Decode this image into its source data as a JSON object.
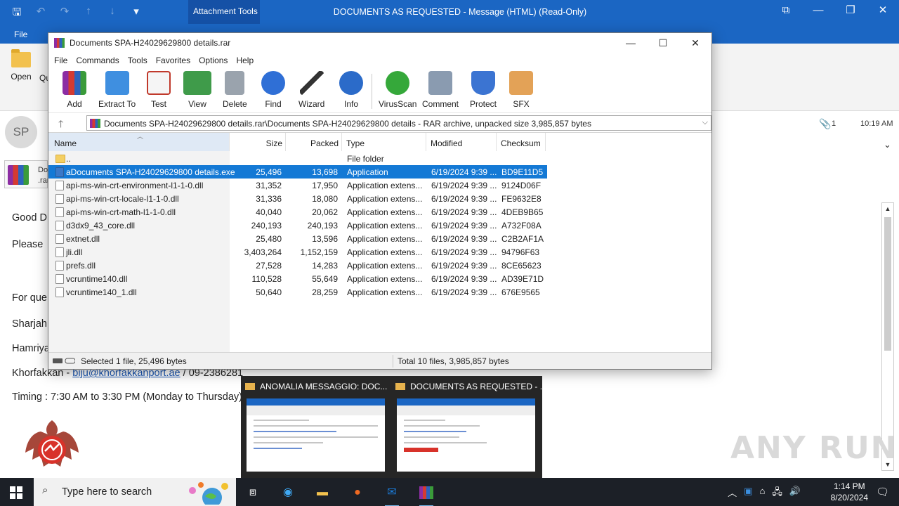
{
  "outlook": {
    "title": "DOCUMENTS AS REQUESTED  -  Message (HTML) (Read-Only)",
    "contextual_tab": "Attachment Tools",
    "file_tab": "File",
    "ribbon_open": "Open",
    "ribbon_qu": "Qu",
    "avatar_initials": "SP",
    "attachment_count": "1",
    "time": "10:19 AM",
    "attachment_name_line1": "Do",
    "attachment_name_line2": ".rar",
    "body": {
      "l1": "Good D",
      "l2": "Please",
      "l3": "For quer",
      "l4": "Sharjah",
      "l5": "Hamriya",
      "l6_prefix": "Khorfakkan - ",
      "l6_email": "biju@khorfakkanport.ae",
      "l6_suffix": " / 09-2386281",
      "l7": "Timing : 7:30 AM to 3:30 PM (Monday to Thursday)"
    }
  },
  "winrar": {
    "title": "Documents SPA-H24029629800 details.rar",
    "menu": [
      "File",
      "Commands",
      "Tools",
      "Favorites",
      "Options",
      "Help"
    ],
    "toolbar": [
      "Add",
      "Extract To",
      "Test",
      "View",
      "Delete",
      "Find",
      "Wizard",
      "Info",
      "VirusScan",
      "Comment",
      "Protect",
      "SFX"
    ],
    "path": "Documents SPA-H24029629800 details.rar\\Documents SPA-H24029629800 details - RAR archive, unpacked size 3,985,857 bytes",
    "columns": {
      "name": "Name",
      "size": "Size",
      "packed": "Packed",
      "type": "Type",
      "modified": "Modified",
      "checksum": "Checksum"
    },
    "files": [
      {
        "name": "..",
        "size": "",
        "packed": "",
        "type": "File folder",
        "modified": "",
        "checksum": "",
        "icon": "folder-icon"
      },
      {
        "name": "aDocuments SPA-H24029629800 details.exe",
        "size": "25,496",
        "packed": "13,698",
        "type": "Application",
        "modified": "6/19/2024 9:39 ...",
        "checksum": "BD9E11D5",
        "icon": "exe-file-icon"
      },
      {
        "name": "api-ms-win-crt-environment-l1-1-0.dll",
        "size": "31,352",
        "packed": "17,950",
        "type": "Application extens...",
        "modified": "6/19/2024 9:39 ...",
        "checksum": "9124D06F",
        "icon": "dll-file-icon"
      },
      {
        "name": "api-ms-win-crt-locale-l1-1-0.dll",
        "size": "31,336",
        "packed": "18,080",
        "type": "Application extens...",
        "modified": "6/19/2024 9:39 ...",
        "checksum": "FE9632E8",
        "icon": "dll-file-icon"
      },
      {
        "name": "api-ms-win-crt-math-l1-1-0.dll",
        "size": "40,040",
        "packed": "20,062",
        "type": "Application extens...",
        "modified": "6/19/2024 9:39 ...",
        "checksum": "4DEB9B65",
        "icon": "dll-file-icon"
      },
      {
        "name": "d3dx9_43_core.dll",
        "size": "240,193",
        "packed": "240,193",
        "type": "Application extens...",
        "modified": "6/19/2024 9:39 ...",
        "checksum": "A732F08A",
        "icon": "dll-file-icon"
      },
      {
        "name": "extnet.dll",
        "size": "25,480",
        "packed": "13,596",
        "type": "Application extens...",
        "modified": "6/19/2024 9:39 ...",
        "checksum": "C2B2AF1A",
        "icon": "dll-file-icon"
      },
      {
        "name": "jli.dll",
        "size": "3,403,264",
        "packed": "1,152,159",
        "type": "Application extens...",
        "modified": "6/19/2024 9:39 ...",
        "checksum": "94796F63",
        "icon": "dll-file-icon"
      },
      {
        "name": "prefs.dll",
        "size": "27,528",
        "packed": "14,283",
        "type": "Application extens...",
        "modified": "6/19/2024 9:39 ...",
        "checksum": "8CE65623",
        "icon": "dll-file-icon"
      },
      {
        "name": "vcruntime140.dll",
        "size": "110,528",
        "packed": "55,649",
        "type": "Application extens...",
        "modified": "6/19/2024 9:39 ...",
        "checksum": "AD39E71D",
        "icon": "dll-file-icon"
      },
      {
        "name": "vcruntime140_1.dll",
        "size": "50,640",
        "packed": "28,259",
        "type": "Application extens...",
        "modified": "6/19/2024 9:39 ...",
        "checksum": "676E9565",
        "icon": "dll-file-icon"
      }
    ],
    "selected_index": 1,
    "status_left": "Selected 1 file, 25,496 bytes",
    "status_right": "Total 10 files, 3,985,857 bytes"
  },
  "thumbnails": [
    {
      "title": "ANOMALIA MESSAGGIO: DOC..."
    },
    {
      "title": "DOCUMENTS AS REQUESTED - ..."
    }
  ],
  "watermark": "ANY RUN",
  "taskbar": {
    "search_placeholder": "Type here to search",
    "time": "1:14 PM",
    "date": "8/20/2024"
  },
  "colors": {
    "outlook_blue": "#1b66c3",
    "selection": "#1479d5",
    "taskbar": "#1c2027"
  }
}
